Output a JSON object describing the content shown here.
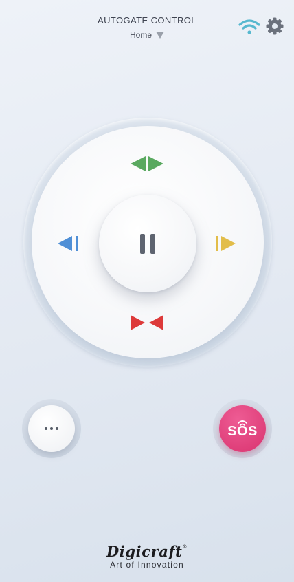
{
  "header": {
    "title": "AUTOGATE CONTROL",
    "location": "Home",
    "location_dropdown_icon": "triangle-down-icon",
    "wifi_icon": "wifi-icon",
    "settings_icon": "gear-icon",
    "wifi_color": "#56b8cf",
    "settings_color": "#6b717c"
  },
  "controls": {
    "open_both": {
      "icon": "open-both-arrows-icon",
      "color": "#5aa960"
    },
    "left": {
      "icon": "left-arrow-icon",
      "color": "#4f8fd6"
    },
    "right": {
      "icon": "right-arrow-icon",
      "color": "#e2bd4a"
    },
    "close_both": {
      "icon": "close-both-arrows-icon",
      "color": "#dd3a3a"
    },
    "pause": {
      "icon": "pause-icon",
      "color": "#5e6470"
    }
  },
  "bottom": {
    "more_icon": "more-dots-icon",
    "sos_label": "SOS",
    "sos_color": "#e0417d",
    "sos_icon": "signal-waves-icon"
  },
  "brand": {
    "name": "Digicraft",
    "trademark": "®",
    "tagline": "Art of Innovation"
  }
}
